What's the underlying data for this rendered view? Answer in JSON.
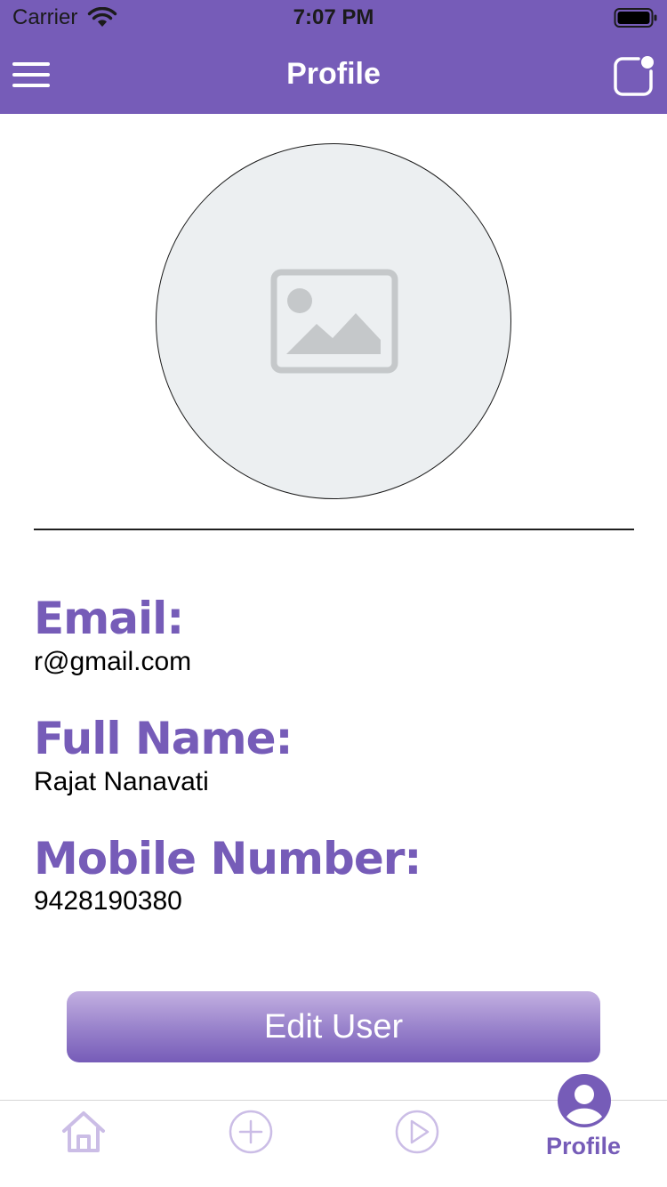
{
  "status_bar": {
    "carrier": "Carrier",
    "time": "7:07 PM"
  },
  "nav": {
    "title": "Profile",
    "left_icon": "hamburger-menu-icon",
    "right_icon": "compose-icon"
  },
  "profile": {
    "avatar_icon": "image-placeholder-icon",
    "fields": [
      {
        "label": "Email:",
        "value": "r@gmail.com"
      },
      {
        "label": "Full Name:",
        "value": "Rajat Nanavati"
      },
      {
        "label": "Mobile Number:",
        "value": "9428190380"
      }
    ],
    "edit_button_label": "Edit User"
  },
  "tabs": [
    {
      "icon": "home-icon",
      "label": "",
      "active": false
    },
    {
      "icon": "plus-circle-icon",
      "label": "",
      "active": false
    },
    {
      "icon": "play-circle-icon",
      "label": "",
      "active": false
    },
    {
      "icon": "user-circle-icon",
      "label": "Profile",
      "active": true
    }
  ],
  "colors": {
    "primary": "#765cb8",
    "inactive_tab": "#cbbde6",
    "avatar_bg": "#eceff1"
  }
}
